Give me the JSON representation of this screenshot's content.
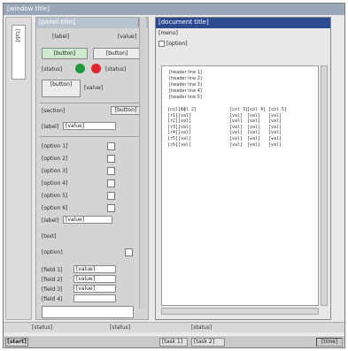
{
  "window": {
    "title": "[window title]"
  },
  "strip": {
    "tab_label": "[tab]"
  },
  "panel": {
    "header": "[panel title]",
    "close_glyph": "×",
    "row1_label": "[label]",
    "row1_value": "[value]",
    "btn_left": "[button]",
    "btn_right": "[button]",
    "dot_green_label": "[status]",
    "dot_red_label": "[status]",
    "small_btn_label": "[button]",
    "small_btn_value": "[value]",
    "section_label": "[section]",
    "section_button": "[button]",
    "name_label": "[label]",
    "name_value": "[value]",
    "checks": [
      {
        "label": "[option 1]"
      },
      {
        "label": "[option 2]"
      },
      {
        "label": "[option 3]"
      },
      {
        "label": "[option 4]"
      },
      {
        "label": "[option 5]"
      },
      {
        "label": "[option 6]"
      }
    ],
    "range_label": "[label]",
    "range_value": "[value]",
    "freq_text": "[text]",
    "auto_label": "[option]",
    "inputs": [
      {
        "label": "[field 1]",
        "value": "[value]"
      },
      {
        "label": "[field 2]",
        "value": "[value]"
      },
      {
        "label": "[field 3]",
        "value": "[value]"
      },
      {
        "label": "[field 4]",
        "value": ""
      }
    ]
  },
  "doc": {
    "title": "[document title]",
    "menu": "[menu]",
    "option_label": "[option]",
    "header_lines": [
      "[header line 1]",
      "[header line 2]",
      "[header line 3]",
      "[header line 4]",
      "[header line 5]"
    ],
    "table_header": [
      "[col 1]",
      "[col 2]",
      "[col 3]",
      "[col 4]",
      "[col 5]"
    ],
    "rows": [
      [
        "[r1]",
        "[val]",
        "[val]",
        "[val]",
        "[val]"
      ],
      [
        "[r2]",
        "[val]",
        "[val]",
        "[val]",
        "[val]"
      ],
      [
        "[r3]",
        "[val]",
        "[val]",
        "[val]",
        "[val]"
      ],
      [
        "[r4]",
        "[val]",
        "[val]",
        "[val]",
        "[val]"
      ],
      [
        "[r5]",
        "[val]",
        "[val]",
        "[val]",
        "[val]"
      ],
      [
        "[r6]",
        "[val]",
        "[val]",
        "[val]",
        "[val]"
      ]
    ]
  },
  "status": {
    "left": "[status]",
    "mid": "[status]",
    "right": "[status]"
  },
  "taskbar": {
    "start_label": "[start]",
    "tasks": [
      "[task 1]",
      "[task 2]"
    ],
    "clock": "[time]"
  },
  "colors": {
    "accent": "#2c4a8f",
    "go": "#1e9a3a",
    "stop": "#e0262e"
  }
}
